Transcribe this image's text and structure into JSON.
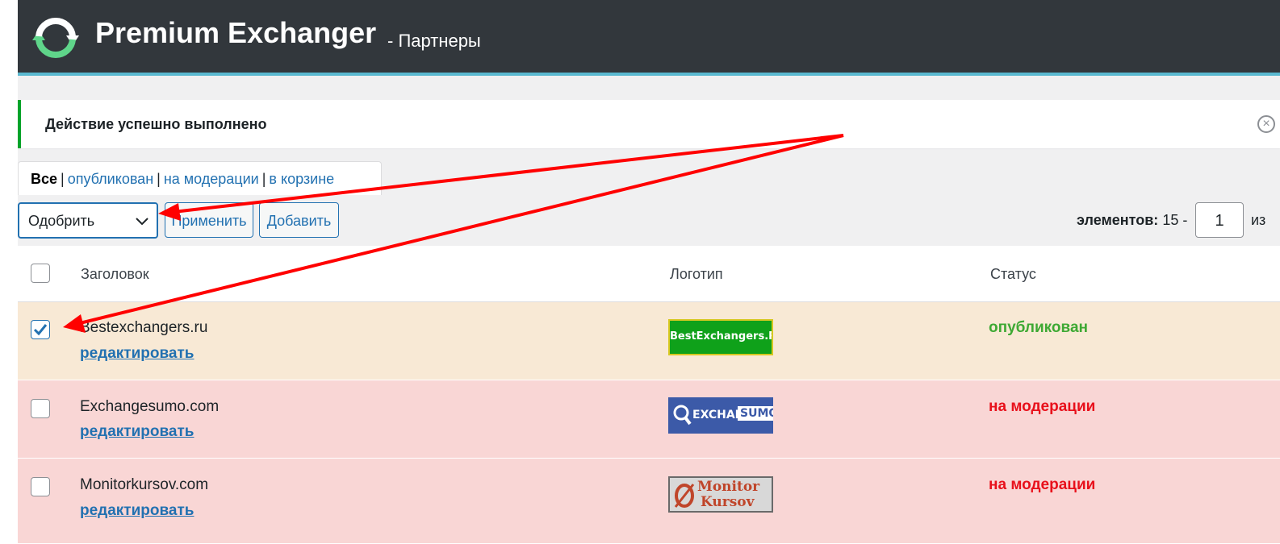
{
  "header": {
    "title": "Premium Exchanger",
    "subtitle": "- Партнеры",
    "logo_icon": "refresh-arrows-icon",
    "bg": "#32373c",
    "accent": "#5ab9d0"
  },
  "notice": {
    "text": "Действие успешно выполнено",
    "dismiss_icon": "close-circle-icon",
    "border_color": "#00a32a"
  },
  "filters": {
    "all": "Все",
    "published": "опубликован",
    "moderation": "на модерации",
    "trash": "в корзине",
    "separator": "|"
  },
  "bulk": {
    "selected": "Одобрить",
    "apply_label": "Применить",
    "add_label": "Добавить"
  },
  "pagination": {
    "items_label": "элементов:",
    "items_value": "15 -",
    "page": "1",
    "of_label": "из"
  },
  "table": {
    "headers": {
      "title": "Заголовок",
      "logo": "Логотип",
      "status": "Статус"
    },
    "rows": [
      {
        "title": "Bestexchangers.ru",
        "edit": "редактировать",
        "logo_text": "BestExchangers.Ru",
        "status": "опубликован",
        "checked": true,
        "status_color": "#3ea934",
        "bg": "#f8e9d5"
      },
      {
        "title": "Exchangesumo.com",
        "edit": "редактировать",
        "logo_text_1": "EXCHANGE",
        "logo_text_2": "SUMO",
        "status": "на модерации",
        "checked": false,
        "status_color": "#e8101b",
        "bg": "#f9d6d5"
      },
      {
        "title": "Monitorkursov.com",
        "edit": "редактировать",
        "logo_text_1": "Monitor",
        "logo_text_2": "Kursov",
        "status": "на модерации",
        "checked": false,
        "status_color": "#e8101b",
        "bg": "#f9d6d5"
      }
    ]
  },
  "annotation": {
    "arrow_color": "#ff0000"
  }
}
